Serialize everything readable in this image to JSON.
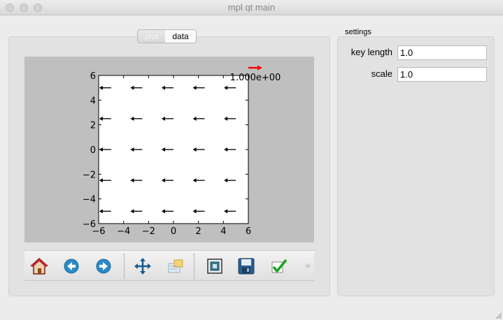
{
  "window": {
    "title": "mpl qt main"
  },
  "tabs": [
    {
      "label": "plot",
      "active": true
    },
    {
      "label": "data",
      "active": false
    }
  ],
  "toolbar": {
    "buttons": [
      "home-icon",
      "back-icon",
      "forward-icon",
      "pan-icon",
      "configure-subplots-icon",
      "zoom-to-rect-icon",
      "save-icon",
      "check-icon"
    ],
    "more": "»"
  },
  "settings": {
    "title": "settings",
    "key_length_label": "key length",
    "key_length_value": "1.0",
    "scale_label": "scale",
    "scale_value": "1.0"
  },
  "colors": {
    "quiver_key": "#ff0000",
    "arrows": "#000000",
    "figure_bg": "#bfbfbf"
  },
  "chart_data": {
    "type": "quiver",
    "xlim": [
      -6,
      6
    ],
    "ylim": [
      -6,
      6
    ],
    "xticks": [
      "−6",
      "−4",
      "−2",
      "0",
      "2",
      "4",
      "6"
    ],
    "yticks": [
      "−6",
      "−4",
      "−2",
      "0",
      "2",
      "4",
      "6"
    ],
    "grid_x": [
      -5,
      -2.5,
      0,
      2.5,
      5
    ],
    "grid_y": [
      -5,
      -2.5,
      0,
      2.5,
      5
    ],
    "u": -1,
    "v": 0,
    "quiverkey_label": "1.000e+00"
  }
}
